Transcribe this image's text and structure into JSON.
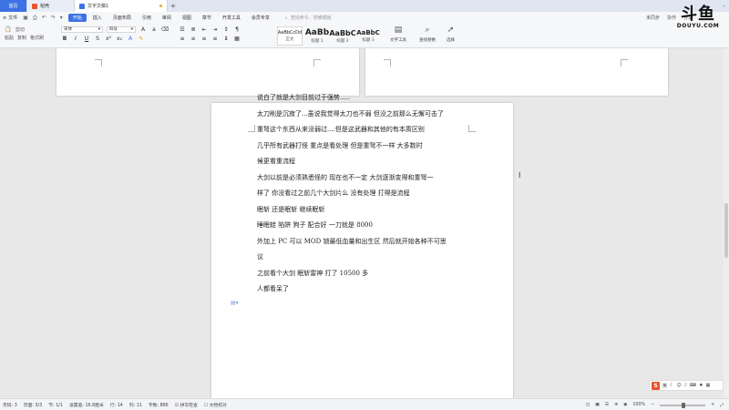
{
  "tabs": {
    "home": "首页",
    "tab2": "稻壳",
    "tab3": "文字文稿1"
  },
  "menu": {
    "file": "文件",
    "items": [
      "开始",
      "插入",
      "页面布局",
      "引用",
      "审阅",
      "视图",
      "章节",
      "开发工具",
      "会员专享"
    ],
    "search_placeholder": "查找命令、搜索模板",
    "unsynced": "未同步",
    "collab": "协作",
    "share": "分享"
  },
  "ribbon": {
    "paste": "粘贴",
    "cut": "剪切",
    "copy": "复制",
    "format_painter": "格式刷",
    "font_name": "宋体",
    "font_size": "四号",
    "styles": [
      {
        "preview": "AaBbCcDd",
        "label": "正文"
      },
      {
        "preview": "AaBb",
        "label": "标题 1"
      },
      {
        "preview": "AaBbC",
        "label": "标题 2"
      },
      {
        "preview": "AaBbC",
        "label": "标题 3"
      }
    ],
    "text_tool": "文字工具",
    "find_replace": "查找替换",
    "select": "选择"
  },
  "document": {
    "lines": [
      "说白了就是大剑目前过于强势.....",
      "太刀削是沉寂了...虽说我觉得太刀也不弱   但没之前那么无懈可击了",
      "重弩这个东西从来没弱过....但是这武器和其他的有本质区别",
      "几乎所有武器打怪     重点是看处理     但是重弩不一样     大多数时",
      "候更看重流程",
      "大剑以前是必须熟悉怪的     现在也不一定     大剑逐渐变得和重弩一",
      "样了     你没看过之前几个大剑片么     没有处理   打得是流程",
      "眠斩     还是眠斩     继续眠斩",
      "睡眠蛙   陷阱     狗子     配合好     一刀就是 8000",
      "外加上 PC 可以 MOD 锁最低血量和出生区     然后就开始各种不可思",
      "议",
      "之前看个大剑     眠斩雷神     打了 10500 多",
      "人都看呆了"
    ]
  },
  "ime": {
    "label": "英"
  },
  "status": {
    "page_num": "页码: 3",
    "pages": "页面: 3/3",
    "section": "节: 1/1",
    "setting": "设置值: 16.8厘米",
    "row": "行: 14",
    "col": "列: 11",
    "words": "字数: 866",
    "spell": "拼写检查",
    "doc_check": "文档校对",
    "zoom": "100%"
  },
  "logo": {
    "main": "斗鱼",
    "sub": "DOUYU.COM"
  },
  "colors": {
    "accent": "#3d72e4",
    "tabbar": "#dfe6f2",
    "canvas": "#e8e8e8"
  }
}
